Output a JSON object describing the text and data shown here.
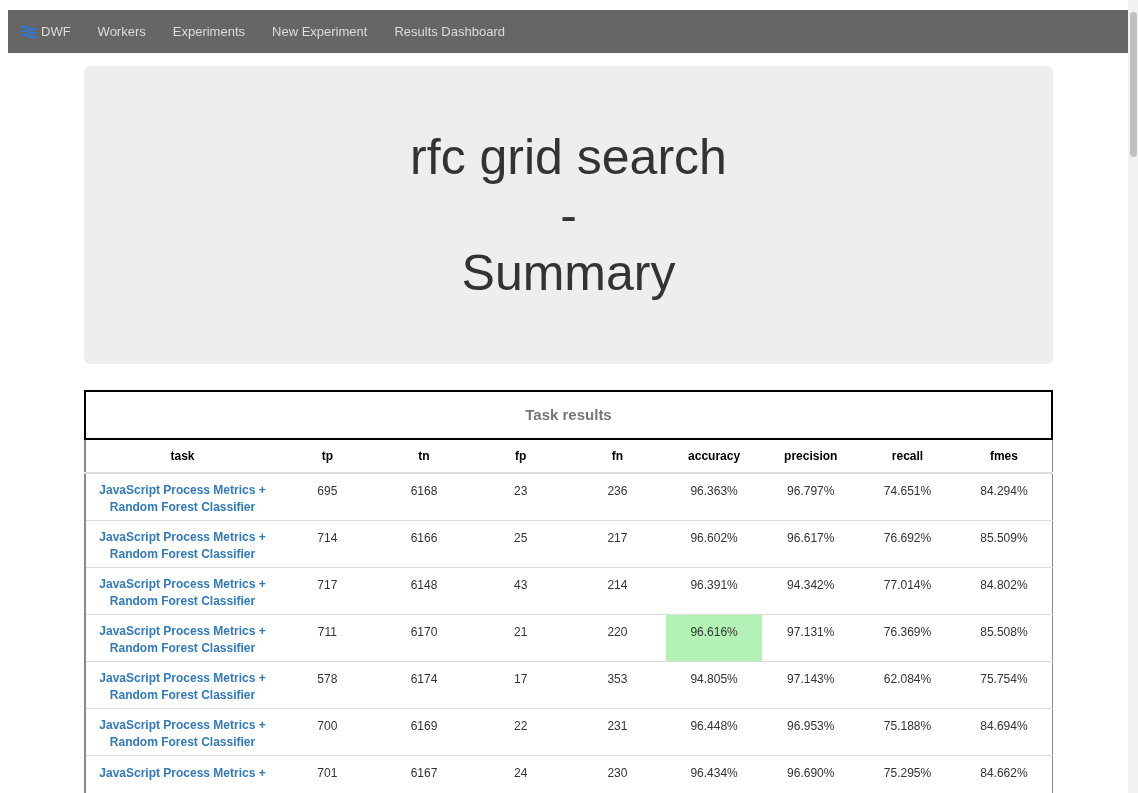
{
  "navbar": {
    "brand": "DWF",
    "links": [
      "Workers",
      "Experiments",
      "New Experiment",
      "Results Dashboard"
    ]
  },
  "jumbotron": {
    "lines": [
      "rfc grid search",
      "-",
      "Summary"
    ]
  },
  "table": {
    "title": "Task results",
    "columns": [
      "task",
      "tp",
      "tn",
      "fp",
      "fn",
      "accuracy",
      "precision",
      "recall",
      "fmes"
    ],
    "rows": [
      {
        "cells": [
          "JavaScript Process Metrics + Random Forest Classifier",
          "695",
          "6168",
          "23",
          "236",
          "96.363%",
          "96.797%",
          "74.651%",
          "84.294%"
        ],
        "accuracy_best": false
      },
      {
        "cells": [
          "JavaScript Process Metrics + Random Forest Classifier",
          "714",
          "6166",
          "25",
          "217",
          "96.602%",
          "96.617%",
          "76.692%",
          "85.509%"
        ],
        "accuracy_best": false
      },
      {
        "cells": [
          "JavaScript Process Metrics + Random Forest Classifier",
          "717",
          "6148",
          "43",
          "214",
          "96.391%",
          "94.342%",
          "77.014%",
          "84.802%"
        ],
        "accuracy_best": false
      },
      {
        "cells": [
          "JavaScript Process Metrics + Random Forest Classifier",
          "711",
          "6170",
          "21",
          "220",
          "96.616%",
          "97.131%",
          "76.369%",
          "85.508%"
        ],
        "accuracy_best": true
      },
      {
        "cells": [
          "JavaScript Process Metrics + Random Forest Classifier",
          "578",
          "6174",
          "17",
          "353",
          "94.805%",
          "97.143%",
          "62.084%",
          "75.754%"
        ],
        "accuracy_best": false
      },
      {
        "cells": [
          "JavaScript Process Metrics + Random Forest Classifier",
          "700",
          "6169",
          "22",
          "231",
          "96.448%",
          "96.953%",
          "75.188%",
          "84.694%"
        ],
        "accuracy_best": false
      },
      {
        "cells": [
          "JavaScript Process Metrics +",
          "701",
          "6167",
          "24",
          "230",
          "96.434%",
          "96.690%",
          "75.295%",
          "84.662%"
        ],
        "accuracy_best": false
      }
    ]
  }
}
